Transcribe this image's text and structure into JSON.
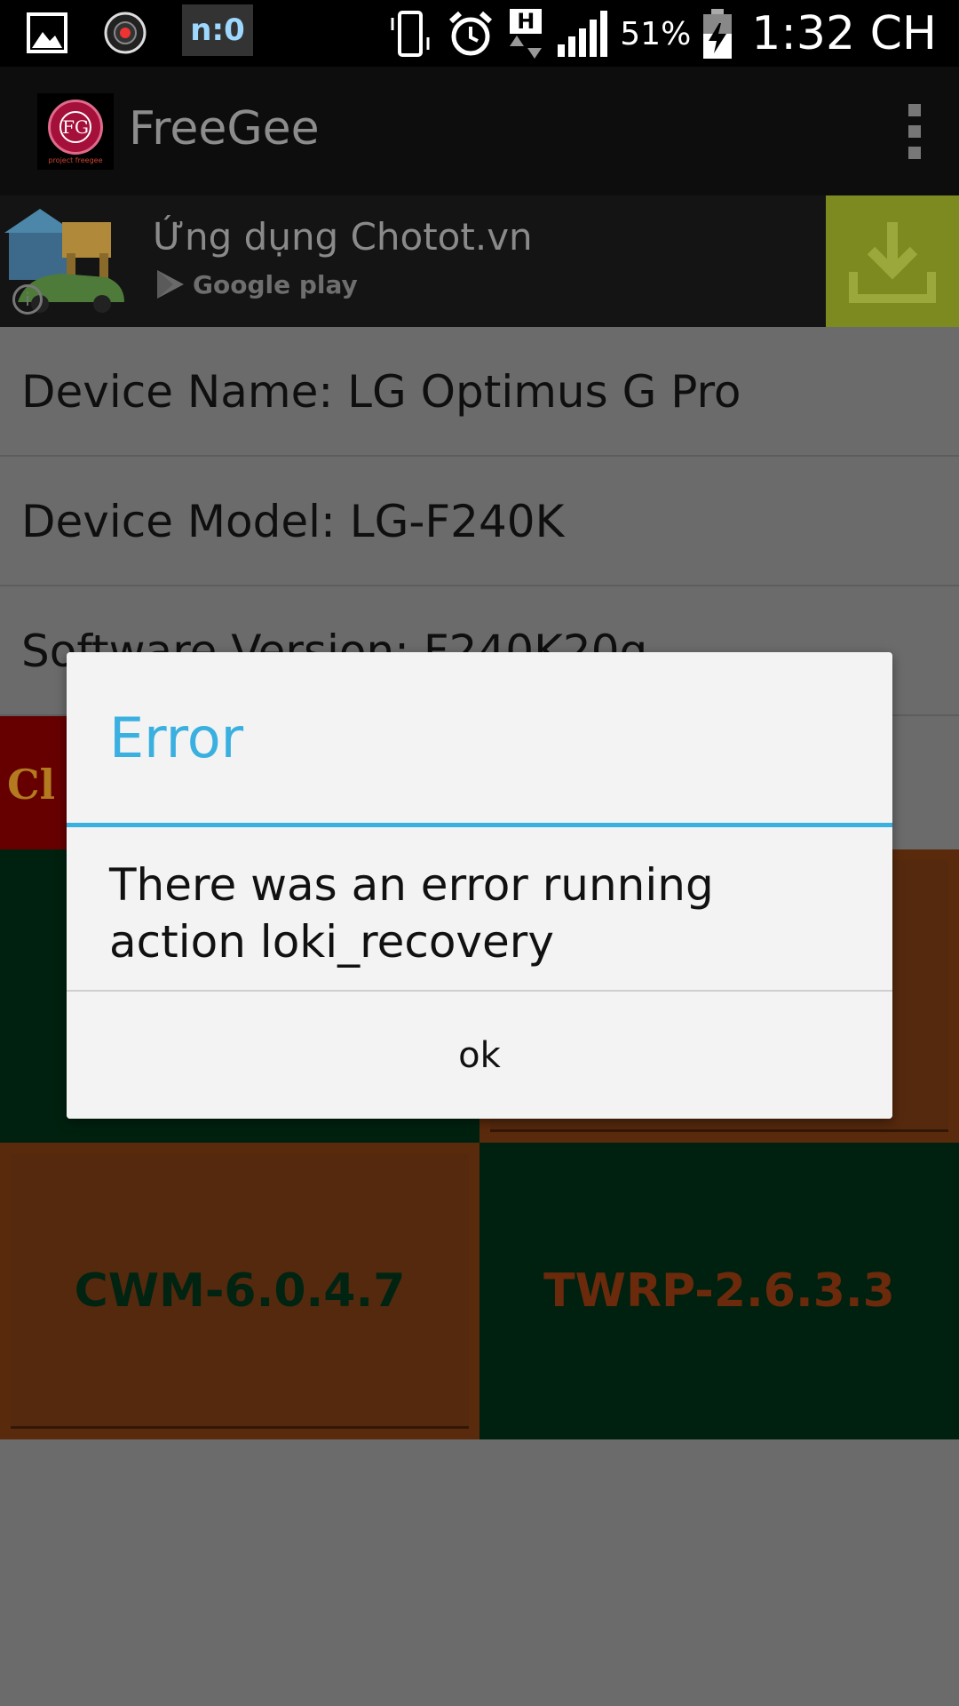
{
  "status_bar": {
    "notification_text": "n:0",
    "network_type": "H",
    "battery_percent": "51%",
    "time": "1:32 CH"
  },
  "action_bar": {
    "app_title": "FreeGee",
    "logo_label": "project freegee"
  },
  "ad": {
    "title": "Ứng dụng Chotot.vn",
    "store": "Google play"
  },
  "device_info": {
    "name_label": "Device Name: LG Optimus G Pro",
    "model_label": "Device Model: LG-F240K",
    "software_label": "Software Version: F240K20g"
  },
  "tiles": {
    "left_ad_label": "Cl",
    "cwm_label": "CWM-6.0.4.7",
    "twrp_label": "TWRP-2.6.3.3"
  },
  "dialog": {
    "title": "Error",
    "message": "There was an error running action loki_recovery",
    "ok_button": "ok"
  },
  "colors": {
    "dialog_accent": "#3ab0e0",
    "tile_green": "#00210f",
    "tile_orange": "#5a2a0c",
    "ad_download_bg": "#7c8a20"
  }
}
